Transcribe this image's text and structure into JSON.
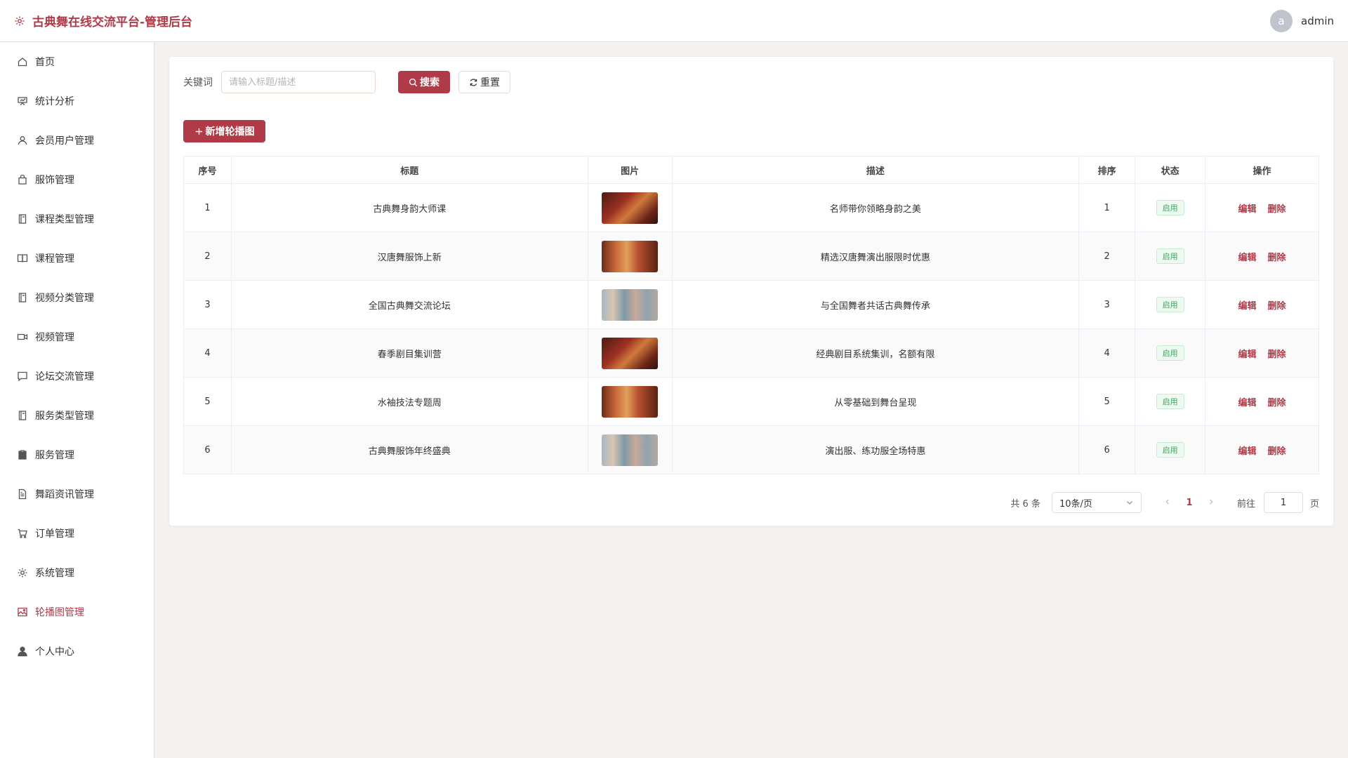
{
  "header": {
    "title": "古典舞在线交流平台-管理后台",
    "avatar_letter": "a",
    "username": "admin"
  },
  "sidebar": {
    "items": [
      {
        "label": "首页",
        "icon": "home-icon"
      },
      {
        "label": "统计分析",
        "icon": "chart-icon"
      },
      {
        "label": "会员用户管理",
        "icon": "user-icon"
      },
      {
        "label": "服饰管理",
        "icon": "bag-icon"
      },
      {
        "label": "课程类型管理",
        "icon": "notebook-icon"
      },
      {
        "label": "课程管理",
        "icon": "book-icon"
      },
      {
        "label": "视频分类管理",
        "icon": "notebook-icon"
      },
      {
        "label": "视频管理",
        "icon": "video-camera-icon"
      },
      {
        "label": "论坛交流管理",
        "icon": "chat-icon"
      },
      {
        "label": "服务类型管理",
        "icon": "notebook-icon"
      },
      {
        "label": "服务管理",
        "icon": "clipboard-icon"
      },
      {
        "label": "舞蹈资讯管理",
        "icon": "document-icon"
      },
      {
        "label": "订单管理",
        "icon": "cart-icon"
      },
      {
        "label": "系统管理",
        "icon": "gear-icon"
      },
      {
        "label": "轮播图管理",
        "icon": "picture-icon"
      },
      {
        "label": "个人中心",
        "icon": "avatar-icon"
      }
    ],
    "active_index": 14
  },
  "search": {
    "label": "关键词",
    "placeholder": "请输入标题/描述",
    "value": "",
    "search_button": "搜索",
    "reset_button": "重置"
  },
  "toolbar": {
    "add_button": "新增轮播图"
  },
  "table": {
    "columns": [
      "序号",
      "标题",
      "图片",
      "描述",
      "排序",
      "状态",
      "操作"
    ],
    "rows": [
      {
        "index": "1",
        "title": "古典舞身韵大师课",
        "image": "thumb-a",
        "desc": "名师带你领略身韵之美",
        "sort": "1",
        "status": "启用"
      },
      {
        "index": "2",
        "title": "汉唐舞服饰上新",
        "image": "thumb-b",
        "desc": "精选汉唐舞演出服限时优惠",
        "sort": "2",
        "status": "启用"
      },
      {
        "index": "3",
        "title": "全国古典舞交流论坛",
        "image": "thumb-c",
        "desc": "与全国舞者共话古典舞传承",
        "sort": "3",
        "status": "启用"
      },
      {
        "index": "4",
        "title": "春季剧目集训营",
        "image": "thumb-a",
        "desc": "经典剧目系统集训，名额有限",
        "sort": "4",
        "status": "启用"
      },
      {
        "index": "5",
        "title": "水袖技法专题周",
        "image": "thumb-b",
        "desc": "从零基础到舞台呈现",
        "sort": "5",
        "status": "启用"
      },
      {
        "index": "6",
        "title": "古典舞服饰年终盛典",
        "image": "thumb-c",
        "desc": "演出服、练功服全场特惠",
        "sort": "6",
        "status": "启用"
      }
    ],
    "edit_label": "编辑",
    "delete_label": "删除"
  },
  "pagination": {
    "total_text": "共 6 条",
    "page_size": "10条/页",
    "current_page": "1",
    "goto_label": "前往",
    "goto_value": "1",
    "goto_suffix": "页"
  },
  "colors": {
    "accent": "#b03a48",
    "success": "#3aa55b"
  }
}
